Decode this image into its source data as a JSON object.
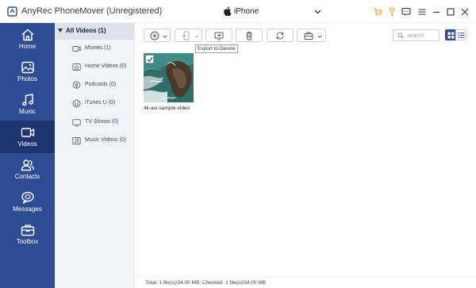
{
  "app": {
    "title": "AnyRec PhoneMover (Unregistered)",
    "accent_color": "#2e4c93",
    "accent_dark": "#1d3470",
    "orange_icon_color": "#f5a623"
  },
  "device": {
    "name": "iPhone",
    "icon": "apple-icon"
  },
  "title_icons": [
    "cart-icon",
    "key-icon",
    "chat-icon",
    "menu-icon",
    "minimize-icon",
    "maximize-icon",
    "close-icon"
  ],
  "sidebar": {
    "items": [
      {
        "label": "Home",
        "icon": "home-icon"
      },
      {
        "label": "Photos",
        "icon": "photos-icon"
      },
      {
        "label": "Music",
        "icon": "music-icon"
      },
      {
        "label": "Videos",
        "icon": "video-icon",
        "active": true
      },
      {
        "label": "Contacts",
        "icon": "contacts-icon"
      },
      {
        "label": "Messages",
        "icon": "messages-icon"
      },
      {
        "label": "Toolbox",
        "icon": "toolbox-icon"
      }
    ]
  },
  "categories": {
    "header": "All Videos (1)",
    "items": [
      {
        "label": "Movies (1)",
        "icon": "movie-icon"
      },
      {
        "label": "Home Videos (0)",
        "icon": "home-video-icon"
      },
      {
        "label": "Podcasts (0)",
        "icon": "podcast-icon"
      },
      {
        "label": "iTunes U (0)",
        "icon": "itunes-u-icon"
      },
      {
        "label": "TV Shows (0)",
        "icon": "tv-icon"
      },
      {
        "label": "Music Videos (0)",
        "icon": "music-video-icon"
      }
    ]
  },
  "toolbar": {
    "buttons": [
      "add-icon",
      "export-to-device-icon",
      "export-to-pc-icon",
      "delete-icon",
      "sync-icon",
      "toolbox-more-icon"
    ],
    "tooltip": "Export to Device",
    "search_placeholder": "search"
  },
  "content": {
    "items": [
      {
        "name": "4k-avi-sample-video",
        "checked": true
      }
    ]
  },
  "status": {
    "text": "Total: 1 file(s)/34.00 MB; Checked: 1 file(s)/34.00 MB"
  }
}
